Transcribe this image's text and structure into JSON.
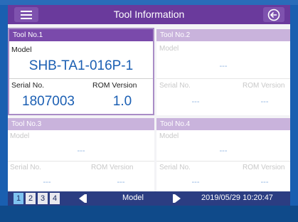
{
  "header": {
    "title": "Tool Information"
  },
  "labels": {
    "model": "Model",
    "serial": "Serial No.",
    "rom": "ROM Version"
  },
  "tools": [
    {
      "name": "Tool No.1",
      "model": "SHB-TA1-016P-1",
      "serial": "1807003",
      "rom": "1.0"
    },
    {
      "name": "Tool No.2",
      "model": "---",
      "serial": "---",
      "rom": "---"
    },
    {
      "name": "Tool No.3",
      "model": "---",
      "serial": "---",
      "rom": "---"
    },
    {
      "name": "Tool No.4",
      "model": "---",
      "serial": "---",
      "rom": "---"
    }
  ],
  "footer": {
    "pages": [
      "1",
      "2",
      "3",
      "4"
    ],
    "mode": "Model",
    "datetime": "2019/05/29 10:20:47"
  },
  "colors": {
    "title_bar": "#6a3a9c",
    "active_panel_header": "#7a4aab",
    "value_blue": "#1b5fb3"
  }
}
